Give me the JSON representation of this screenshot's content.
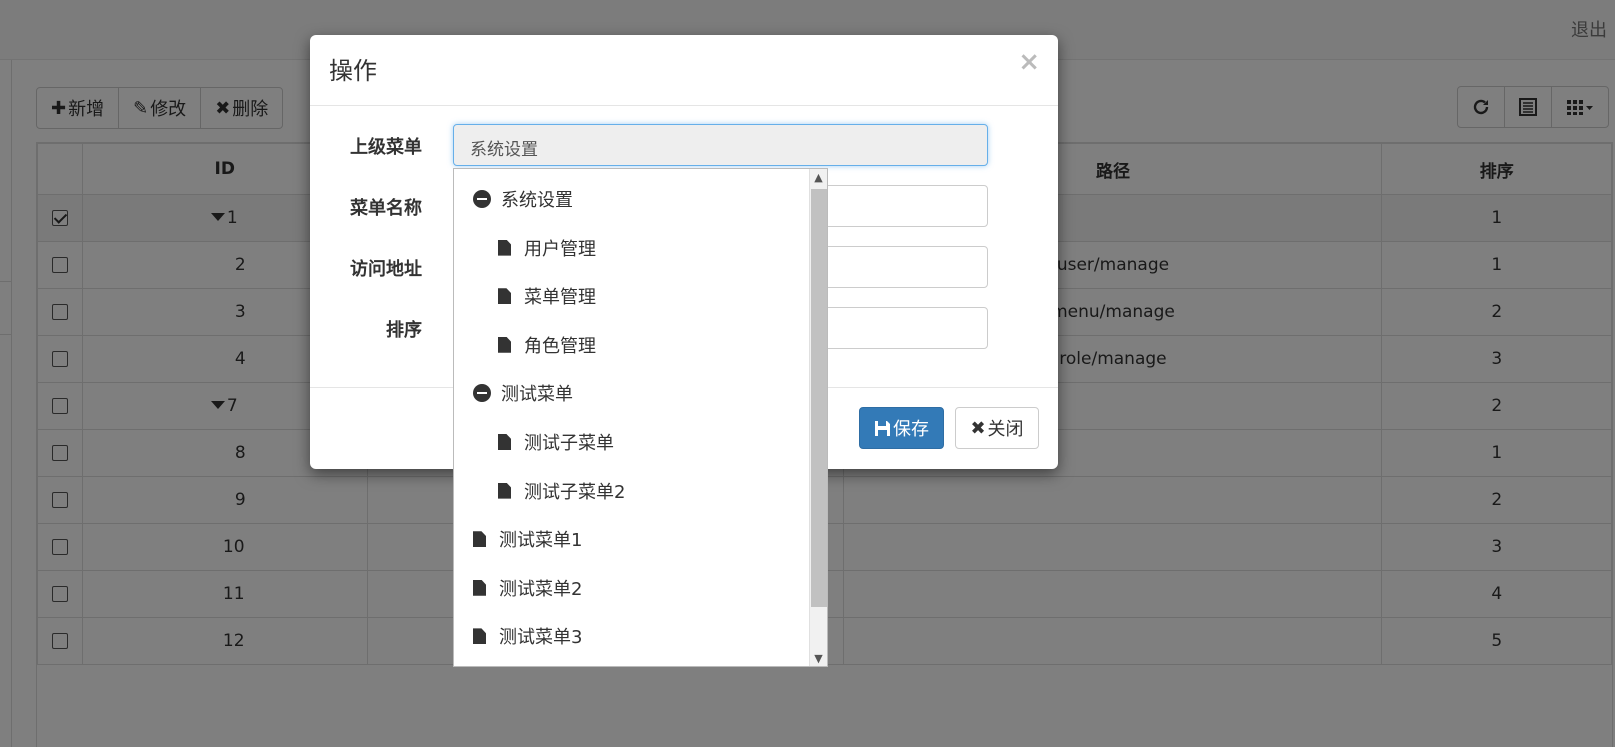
{
  "header": {
    "logout": "退出"
  },
  "toolbar": {
    "add": {
      "icon": "✚",
      "label": "新增"
    },
    "edit": {
      "icon": "✎",
      "label": "修改"
    },
    "delete": {
      "icon": "✖",
      "label": "删除"
    }
  },
  "right_tools": {
    "refresh_icon": "refresh-icon",
    "toggle_icon": "list-view-icon",
    "columns_icon": "columns-icon"
  },
  "table": {
    "headers": {
      "id": "ID",
      "path": "路径",
      "sort": "排序"
    },
    "rows": [
      {
        "checked": true,
        "id": "1",
        "expandable": true,
        "path": "",
        "sort": "1"
      },
      {
        "checked": false,
        "id": "2",
        "expandable": false,
        "path": "user/manage",
        "sort": "1"
      },
      {
        "checked": false,
        "id": "3",
        "expandable": false,
        "path": "menu/manage",
        "sort": "2"
      },
      {
        "checked": false,
        "id": "4",
        "expandable": false,
        "path": "role/manage",
        "sort": "3"
      },
      {
        "checked": false,
        "id": "7",
        "expandable": true,
        "path": "",
        "sort": "2"
      },
      {
        "checked": false,
        "id": "8",
        "expandable": false,
        "path": "",
        "sort": "1"
      },
      {
        "checked": false,
        "id": "9",
        "expandable": false,
        "path": "",
        "sort": "2"
      },
      {
        "checked": false,
        "id": "10",
        "expandable": false,
        "path": "",
        "sort": "3"
      },
      {
        "checked": false,
        "id": "11",
        "expandable": false,
        "path": "",
        "sort": "4"
      },
      {
        "checked": false,
        "id": "12",
        "expandable": false,
        "path": "",
        "sort": "5"
      }
    ]
  },
  "modal": {
    "title": "操作",
    "close": "×",
    "fields": {
      "parent": {
        "label": "上级菜单",
        "value": "系统设置"
      },
      "name": {
        "label": "菜单名称",
        "value": ""
      },
      "url": {
        "label": "访问地址",
        "value": ""
      },
      "sort": {
        "label": "排序",
        "value": ""
      }
    },
    "save": {
      "icon": "💾",
      "label": "保存"
    },
    "cancel": {
      "icon": "✖",
      "label": "关闭"
    }
  },
  "tree": {
    "nodes": [
      {
        "label": "系统设置",
        "type": "folder-open",
        "level": 0
      },
      {
        "label": "用户管理",
        "type": "file",
        "level": 1
      },
      {
        "label": "菜单管理",
        "type": "file",
        "level": 1
      },
      {
        "label": "角色管理",
        "type": "file",
        "level": 1
      },
      {
        "label": "测试菜单",
        "type": "folder-open",
        "level": 0
      },
      {
        "label": "测试子菜单",
        "type": "file",
        "level": 1
      },
      {
        "label": "测试子菜单2",
        "type": "file",
        "level": 1
      },
      {
        "label": "测试菜单1",
        "type": "file",
        "level": 0
      },
      {
        "label": "测试菜单2",
        "type": "file",
        "level": 0
      },
      {
        "label": "测试菜单3",
        "type": "file",
        "level": 0
      }
    ]
  }
}
